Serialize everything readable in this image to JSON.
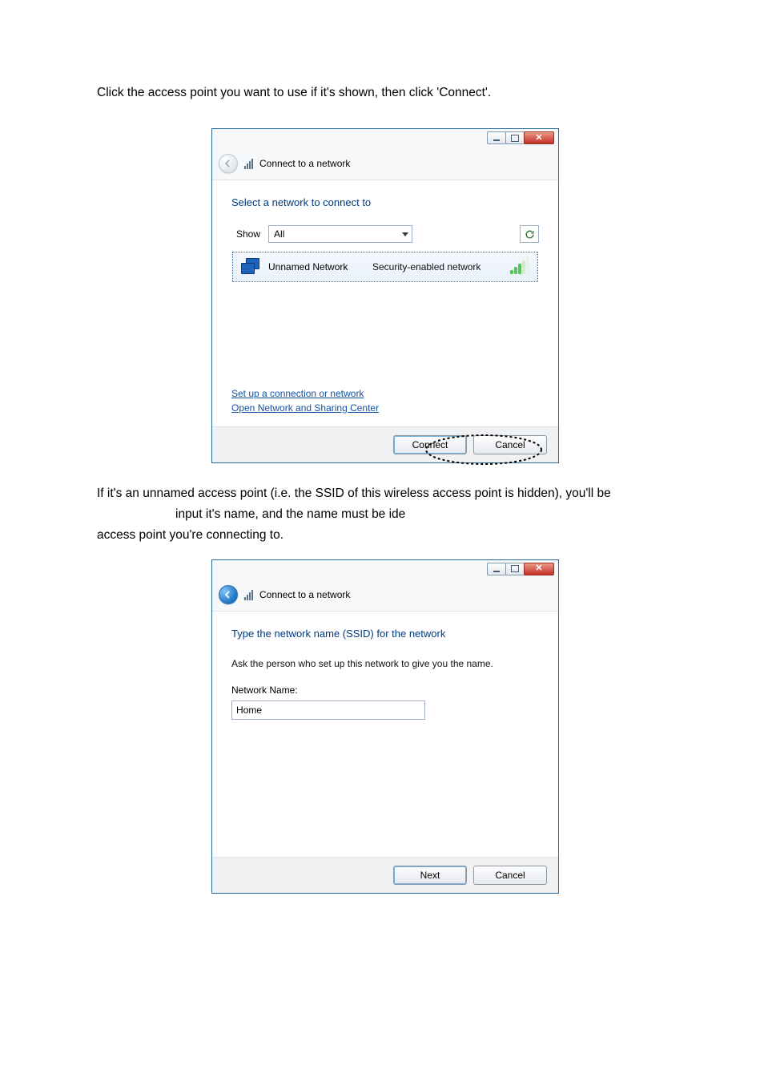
{
  "text": {
    "para1": "Click the access point you want to use if it's shown, then click 'Connect'.",
    "para2_line1": "If it's an unnamed access point (i.e. the SSID of this wireless access point is hidden), you'll be",
    "para2_line2": "input it's name, and the name must be ide",
    "para2_line3": "access point you're connecting to."
  },
  "dlg1": {
    "title": "Connect to a network",
    "heading": "Select a network to connect to",
    "show_label": "Show",
    "show_value": "All",
    "network": {
      "name": "Unnamed Network",
      "security": "Security-enabled network"
    },
    "links": {
      "setup": "Set up a connection or network",
      "open_center": "Open Network and Sharing Center"
    },
    "buttons": {
      "connect": "Connect",
      "cancel": "Cancel"
    }
  },
  "dlg2": {
    "title": "Connect to a network",
    "heading": "Type the network name (SSID) for the network",
    "hint": "Ask the person who set up this network to give you the name.",
    "field_label": "Network Name:",
    "field_value": "Home",
    "buttons": {
      "next": "Next",
      "cancel": "Cancel"
    }
  }
}
